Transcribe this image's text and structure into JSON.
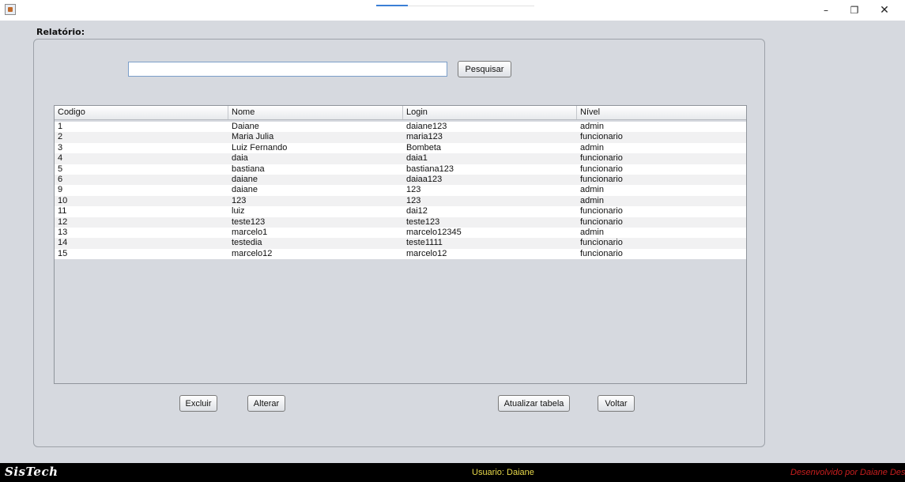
{
  "window": {
    "minimize_glyph": "–",
    "maximize_glyph": "❐",
    "close_glyph": "✕",
    "icon": "java-app-icon"
  },
  "report": {
    "heading": "Relatório:"
  },
  "search": {
    "value": "",
    "placeholder": "",
    "button_label": "Pesquisar"
  },
  "table": {
    "columns": [
      "Codigo",
      "Nome",
      "Login",
      "Nível"
    ],
    "rows": [
      [
        "1",
        "Daiane",
        "daiane123",
        "admin"
      ],
      [
        "2",
        "Maria Julia",
        "maria123",
        "funcionario"
      ],
      [
        "3",
        "Luiz Fernando",
        "Bombeta",
        "admin"
      ],
      [
        "4",
        "daia",
        "daia1",
        "funcionario"
      ],
      [
        "5",
        "bastiana",
        "bastiana123",
        "funcionario"
      ],
      [
        "6",
        "daiane",
        "daiaa123",
        "funcionario"
      ],
      [
        "9",
        "daiane",
        "123",
        "admin"
      ],
      [
        "10",
        "123",
        "123",
        "admin"
      ],
      [
        "11",
        "luiz",
        "dai12",
        "funcionario"
      ],
      [
        "12",
        "teste123",
        "teste123",
        "funcionario"
      ],
      [
        "13",
        "marcelo1",
        "marcelo12345",
        "admin"
      ],
      [
        "14",
        "testedia",
        "teste1111",
        "funcionario"
      ],
      [
        "15",
        "marcelo12",
        "marcelo12",
        "funcionario"
      ]
    ]
  },
  "actions": {
    "delete_label": "Excluir",
    "edit_label": "Alterar",
    "refresh_label": "Atualizar tabela",
    "back_label": "Voltar"
  },
  "statusbar": {
    "brand": "SisTech",
    "user": "Usuario: Daiane",
    "developer": "Desenvolvido por Daiane Destr"
  },
  "colors": {
    "background": "#d6d9df",
    "statusbar_bg": "#000000",
    "user_text": "#e8d94a",
    "developer_text": "#c81e1e",
    "input_border": "#7c9fc9"
  }
}
